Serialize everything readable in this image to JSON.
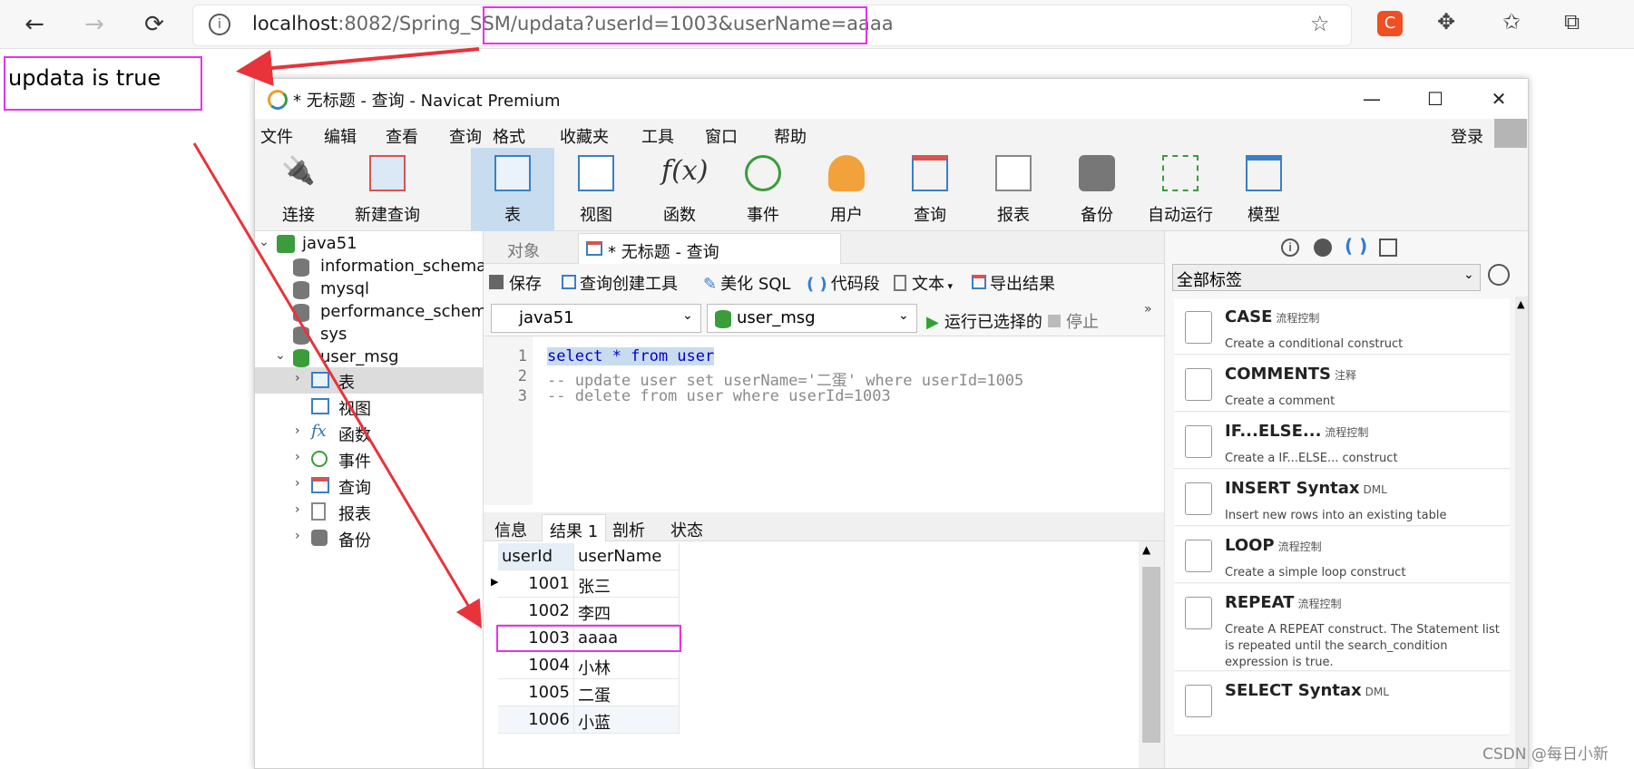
{
  "browser": {
    "url_host": "localhost",
    "url_rest": ":8082/Spring_SSM/",
    "url_query": "updata?userId=1003&userName=aaaa"
  },
  "page": {
    "response_text": "updata is true"
  },
  "navicat": {
    "title": "* 无标题 - 查询 - Navicat Premium",
    "login_label": "登录",
    "menu": [
      "文件",
      "编辑",
      "查看",
      "查询",
      "格式",
      "收藏夹",
      "工具",
      "窗口",
      "帮助"
    ],
    "toolbar": [
      "连接",
      "新建查询",
      "表",
      "视图",
      "函数",
      "事件",
      "用户",
      "查询",
      "报表",
      "备份",
      "自动运行",
      "模型"
    ],
    "tree": {
      "connection": "java51",
      "databases": [
        "information_schema",
        "mysql",
        "performance_schema",
        "sys",
        "user_msg"
      ],
      "objects": [
        "表",
        "视图",
        "函数",
        "事件",
        "查询",
        "报表",
        "备份"
      ]
    },
    "tabs": {
      "objects": "对象",
      "query": "* 无标题 - 查询"
    },
    "query_toolbar": {
      "save": "保存",
      "builder": "查询创建工具",
      "beautify": "美化 SQL",
      "snippet": "代码段",
      "text": "文本",
      "export": "导出结果"
    },
    "selectors": {
      "connection": "java51",
      "database": "user_msg",
      "run": "运行已选择的",
      "stop": "停止"
    },
    "editor_lines": [
      "select * from user",
      "-- update user set userName='二蛋' where userId=1005",
      "-- delete from user where userId=1003"
    ],
    "result_tabs": [
      "信息",
      "结果 1",
      "剖析",
      "状态"
    ],
    "grid": {
      "columns": [
        "userId",
        "userName"
      ],
      "rows": [
        [
          "1001",
          "张三"
        ],
        [
          "1002",
          "李四"
        ],
        [
          "1003",
          "aaaa"
        ],
        [
          "1004",
          "小林"
        ],
        [
          "1005",
          "二蛋"
        ],
        [
          "1006",
          "小蓝"
        ]
      ]
    },
    "right_panel": {
      "filter": "全部标签",
      "snippets": [
        {
          "name": "CASE",
          "tag": "流程控制",
          "desc": "Create a conditional construct"
        },
        {
          "name": "COMMENTS",
          "tag": "注释",
          "desc": "Create a comment"
        },
        {
          "name": "IF...ELSE...",
          "tag": "流程控制",
          "desc": "Create a IF...ELSE... construct"
        },
        {
          "name": "INSERT Syntax",
          "tag": "DML",
          "desc": "Insert new rows into an existing table"
        },
        {
          "name": "LOOP",
          "tag": "流程控制",
          "desc": "Create a simple loop construct"
        },
        {
          "name": "REPEAT",
          "tag": "流程控制",
          "desc": "Create A REPEAT construct. The Statement list is repeated until the search_condition expression is true."
        },
        {
          "name": "SELECT Syntax",
          "tag": "DML",
          "desc": ""
        }
      ]
    }
  },
  "watermark": "CSDN @每日小新",
  "colors": {
    "highlight": "#e832e8",
    "arrow": "#e8333a",
    "selection": "#c8dcef",
    "keyword": "#0000cc",
    "comment": "#8a8a8a"
  }
}
